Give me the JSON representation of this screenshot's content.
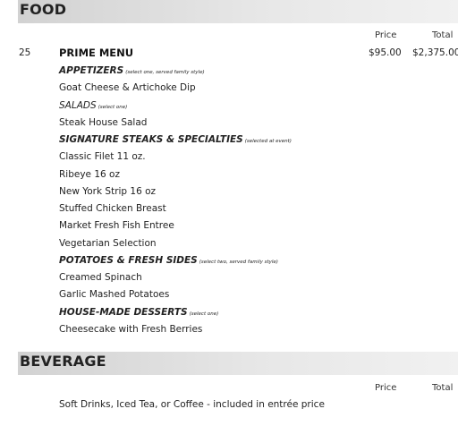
{
  "food": {
    "title": "FOOD",
    "price_header": "Price",
    "total_header": "Total",
    "qty": "25",
    "menu_name": "PRIME MENU",
    "price": "$95.00",
    "total": "$2,375.00",
    "lines": [
      {
        "kind": "category",
        "text": "APPETIZERS",
        "note": "(select one, served family style)"
      },
      {
        "kind": "item",
        "text": "Goat Cheese & Artichoke Dip"
      },
      {
        "kind": "category_light",
        "text": "SALADS",
        "note": "(select one)"
      },
      {
        "kind": "item",
        "text": "Steak House Salad"
      },
      {
        "kind": "category",
        "text": "SIGNATURE STEAKS & SPECIALTIES",
        "note": "(selected at event)"
      },
      {
        "kind": "item",
        "text": "Classic Filet 11 oz."
      },
      {
        "kind": "item",
        "text": "Ribeye 16 oz"
      },
      {
        "kind": "item",
        "text": "New York Strip 16 oz"
      },
      {
        "kind": "item",
        "text": "Stuffed Chicken Breast"
      },
      {
        "kind": "item",
        "text": "Market Fresh Fish Entree"
      },
      {
        "kind": "item",
        "text": "Vegetarian Selection"
      },
      {
        "kind": "category",
        "text": "POTATOES & FRESH SIDES",
        "note": "(select two, served family style)"
      },
      {
        "kind": "item",
        "text": "Creamed Spinach"
      },
      {
        "kind": "item",
        "text": "Garlic Mashed Potatoes"
      },
      {
        "kind": "category",
        "text": "HOUSE-MADE DESSERTS",
        "note": "(select one)"
      },
      {
        "kind": "item",
        "text": "Cheesecake with Fresh Berries"
      }
    ]
  },
  "beverage": {
    "title": "BEVERAGE",
    "price_header": "Price",
    "total_header": "Total",
    "item": "Soft Drinks, Iced Tea, or Coffee - included in entrée price"
  }
}
